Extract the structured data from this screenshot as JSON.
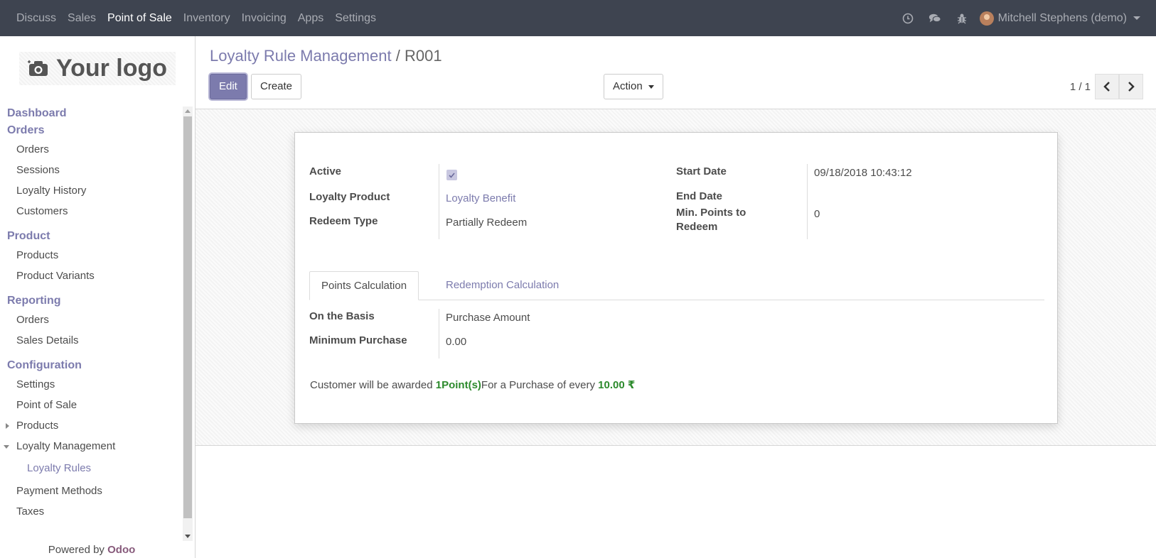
{
  "topbar": {
    "menu": [
      "Discuss",
      "Sales",
      "Point of Sale",
      "Inventory",
      "Invoicing",
      "Apps",
      "Settings"
    ],
    "active_index": 2,
    "user_name": "Mitchell Stephens (demo)",
    "icons": [
      "clock-icon",
      "chat-icon",
      "bug-icon"
    ]
  },
  "sidebar": {
    "logo_text": "Your logo",
    "sections": {
      "dashboard": "Dashboard",
      "orders": "Orders",
      "product": "Product",
      "reporting": "Reporting",
      "configuration": "Configuration"
    },
    "orders_items": [
      "Orders",
      "Sessions",
      "Loyalty History",
      "Customers"
    ],
    "product_items": [
      "Products",
      "Product Variants"
    ],
    "reporting_items": [
      "Orders",
      "Sales Details"
    ],
    "config_items": {
      "settings": "Settings",
      "point_of_sale": "Point of Sale",
      "products": "Products",
      "loyalty_management": "Loyalty Management",
      "loyalty_rules": "Loyalty Rules",
      "payment_methods": "Payment Methods",
      "taxes": "Taxes"
    },
    "powered_prefix": "Powered by",
    "powered_brand": "Odoo"
  },
  "control": {
    "breadcrumb_parent": "Loyalty Rule Management",
    "breadcrumb_sep": "/",
    "breadcrumb_current": "R001",
    "edit_label": "Edit",
    "create_label": "Create",
    "action_label": "Action",
    "pager_value": "1 / 1"
  },
  "form": {
    "active_label": "Active",
    "active_checked": true,
    "loyalty_product_label": "Loyalty Product",
    "loyalty_product_value": "Loyalty Benefit",
    "redeem_type_label": "Redeem Type",
    "redeem_type_value": "Partially Redeem",
    "start_date_label": "Start Date",
    "start_date_value": "09/18/2018 10:43:12",
    "end_date_label": "End Date",
    "end_date_value": "",
    "min_points_label_1": "Min. Points to",
    "min_points_label_2": "Redeem",
    "min_points_value": "0",
    "tabs": [
      "Points Calculation",
      "Redemption Calculation"
    ],
    "active_tab": 0,
    "basis_label": "On the Basis",
    "basis_value": "Purchase Amount",
    "min_purchase_label": "Minimum Purchase",
    "min_purchase_value": "0.00",
    "award_prefix": "Customer will be awarded",
    "award_points": "1Point(s)",
    "award_middle": "For a Purchase of every",
    "award_amount": "10.00 ₹"
  },
  "colors": {
    "navbar_bg": "#3e4450",
    "accent": "#7c7bad",
    "award_green": "#2c8a2c"
  }
}
